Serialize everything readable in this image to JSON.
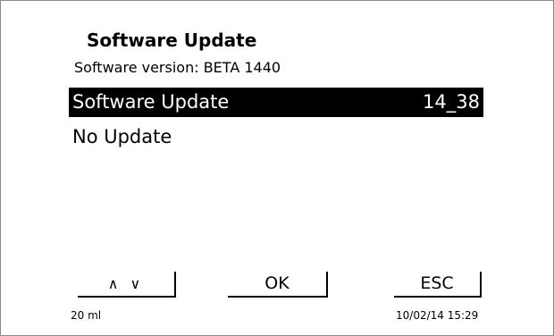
{
  "header": {
    "title": "Software Update",
    "subtitle": "Software version: BETA 1440"
  },
  "menu": {
    "items": [
      {
        "label": "Software Update",
        "value": "14_38",
        "selected": true
      },
      {
        "label": "No Update",
        "value": "",
        "selected": false
      }
    ]
  },
  "softkeys": {
    "nav_label": "∧ ∨",
    "ok_label": "OK",
    "esc_label": "ESC"
  },
  "status": {
    "volume": "20 ml",
    "datetime": "10/02/14 15:29"
  }
}
